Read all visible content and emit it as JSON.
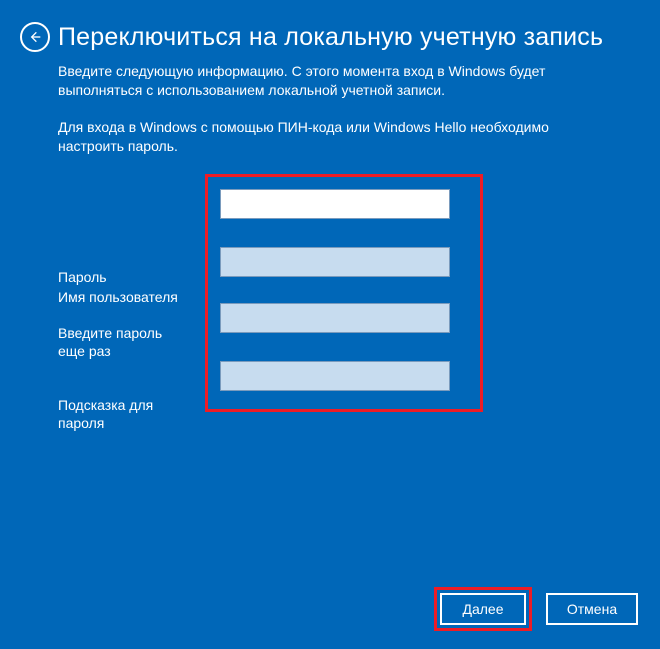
{
  "header": {
    "title": "Переключиться на локальную учетную запись"
  },
  "intro": {
    "line1": "Введите следующую информацию. С этого момента вход в Windows будет выполняться с использованием локальной учетной записи.",
    "line2": "Для входа в Windows с помощью ПИН-кода или Windows Hello необходимо настроить пароль."
  },
  "form": {
    "username_label": "Имя пользователя",
    "username_value": "",
    "password_label": "Пароль",
    "password_value": "",
    "confirm_label": "Введите пароль еще раз",
    "confirm_value": "",
    "hint_label": "Подсказка для пароля",
    "hint_value": ""
  },
  "footer": {
    "next_label": "Далее",
    "cancel_label": "Отмена"
  }
}
